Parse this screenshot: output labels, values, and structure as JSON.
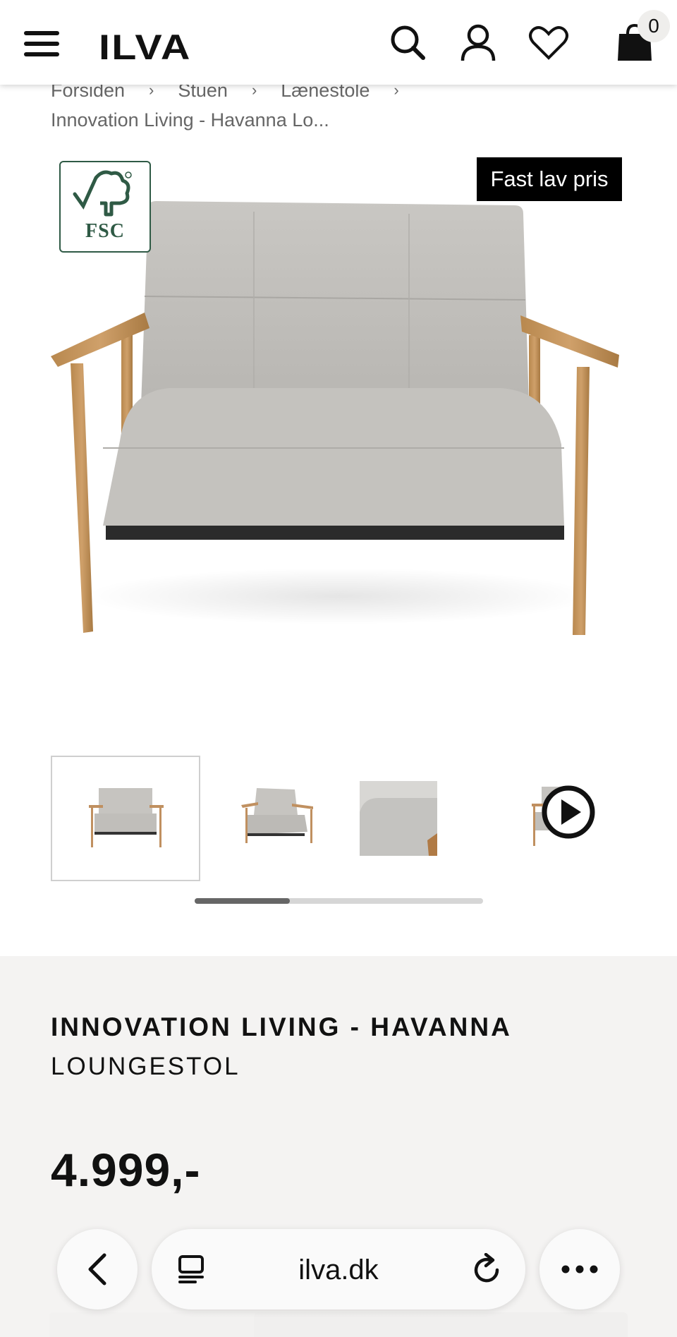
{
  "header": {
    "logo": "ILVA",
    "cart_count": "0",
    "icons": [
      "hamburger-menu-icon",
      "search-icon",
      "user-icon",
      "heart-icon",
      "shopping-bag-icon"
    ]
  },
  "breadcrumb": {
    "items": [
      "Forsiden",
      "Stuen",
      "Lænestole"
    ],
    "separator": "›",
    "current": "Innovation Living - Havanna Lo..."
  },
  "gallery": {
    "badge_label": "FSC",
    "price_badge": "Fast lav pris",
    "thumbnails_count": 4,
    "active_thumbnail": 0,
    "scroll_fraction": 0.33
  },
  "product": {
    "brand_title": "INNOVATION LIVING - HAVANNA",
    "type": "LOUNGESTOL",
    "price": "4.999,-"
  },
  "browser": {
    "url": "ilva.dk",
    "icons": [
      "back-chevron-icon",
      "tabs-icon",
      "reload-icon",
      "more-icon"
    ]
  },
  "colors": {
    "fsc_green": "#2f5a45",
    "price_badge_bg": "#000000",
    "panel_bg": "#f4f3f2"
  }
}
